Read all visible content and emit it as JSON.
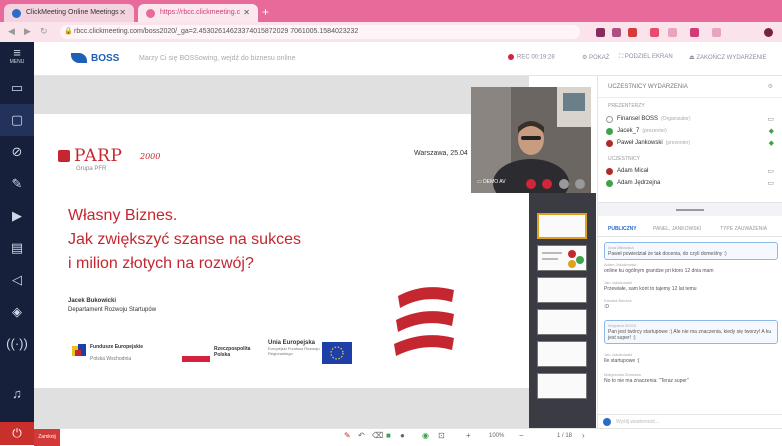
{
  "browser": {
    "tabs": [
      {
        "label": "ClickMeeting Online Meetings",
        "active": false
      },
      {
        "label": "https://rbcc.clickmeeting.c",
        "active": true
      }
    ],
    "url": "rbcc.clickmeeting.com/boss2020/_ga=2.45302614623374015872029 7061005.1584023232"
  },
  "sidebar": {
    "menu_label": "MENU",
    "items": [
      "screen-icon",
      "presentation-icon",
      "block-icon",
      "brush-icon",
      "youtube-icon",
      "files-icon",
      "share-icon",
      "layers-icon",
      "broadcast-icon",
      "speaker-icon"
    ]
  },
  "header": {
    "logo_text": "BOSS",
    "message": "Marzy Ci się BOSSowing, wejdź do biznesu online",
    "rec_label": "REC 00:19:28",
    "btn1": "POKAŻ",
    "btn2": "PODZIEL EKRAN",
    "btn3": "ZAKOŃCZ WYDARZENIE"
  },
  "slide": {
    "logo_name": "PARP",
    "logo_suffix": "2000",
    "logo_sub": "Grupa PFR",
    "place_date": "Warszawa, 25.04",
    "title_lines": [
      "Własny Biznes.",
      "Jak zwiększyć szanse na sukces",
      "i milion złotych na rozwój?"
    ],
    "author_name": "Jacek Bukowicki",
    "author_dept": "Departament Rozwoju Startupów",
    "fund1": "Fundusze Europejskie",
    "fund1_sub": "Polska Wschodnia",
    "fund2": "Rzeczpospolita Polska",
    "fund3": "Unia Europejska",
    "fund3_sub": "Europejski Fundusz Rozwoju Regionalnego"
  },
  "video": {
    "label": "DEMO AV"
  },
  "panel": {
    "header": "UCZESTNICY WYDARZENIA",
    "section1": "PREZENTERZY",
    "section2": "UCZESTNICY",
    "users_top": [
      {
        "name": "Finansel BOSS",
        "role": "(Organizator)",
        "color": "#ffffff"
      },
      {
        "name": "Jacek_7",
        "role": "(prezenter)",
        "color": "#3fa34d"
      },
      {
        "name": "Paweł Jankowski",
        "role": "(prezenter)",
        "color": "#b02a2a"
      }
    ],
    "users_bottom": [
      {
        "name": "Adam Micał",
        "role": "",
        "color": "#b02a2a"
      },
      {
        "name": "Adam Jędrzejna",
        "role": "",
        "color": "#3fa34d"
      }
    ],
    "chat_tabs": [
      "PUBLICZNY",
      "PANEL, JANKOWSKI",
      "TYPE ZAUWAŻENIA"
    ],
    "messages": [
      {
        "author": "Ania Miłowska",
        "text": "Paweł powiedział że tak docenia, do czyli domeślny :)",
        "boxed": true
      },
      {
        "author": "Adam Jakubowski",
        "text": "online ku ogólnym grandze pri ktoro 12 dnia mam",
        "boxed": false
      },
      {
        "author": "Jan Jakubowski",
        "text": "Przewiałe, sam kont to tajemy 12 lat temu",
        "boxed": false
      },
      {
        "author": "Klaudia Baczek",
        "text": ":D",
        "boxed": false
      },
      {
        "author": "Wojciech BOSS",
        "text": "Pan jest twórcy startupowe :) Ale nie ma znaczenia, kiedy się tworzy! A ku jest super! :)",
        "boxed": true
      },
      {
        "author": "Jan Jakubowski",
        "text": "Ile startupowe :(",
        "boxed": false
      },
      {
        "author": "Małgorzata Zbowska",
        "text": "No to nie ma znaczenia: \"Teraz super\"",
        "boxed": false
      }
    ],
    "chat_placeholder": "Wyślij wiadomość..."
  },
  "toolbar": {
    "left_label": "Zamknij",
    "zoom": "100%",
    "page": "1 / 18"
  }
}
